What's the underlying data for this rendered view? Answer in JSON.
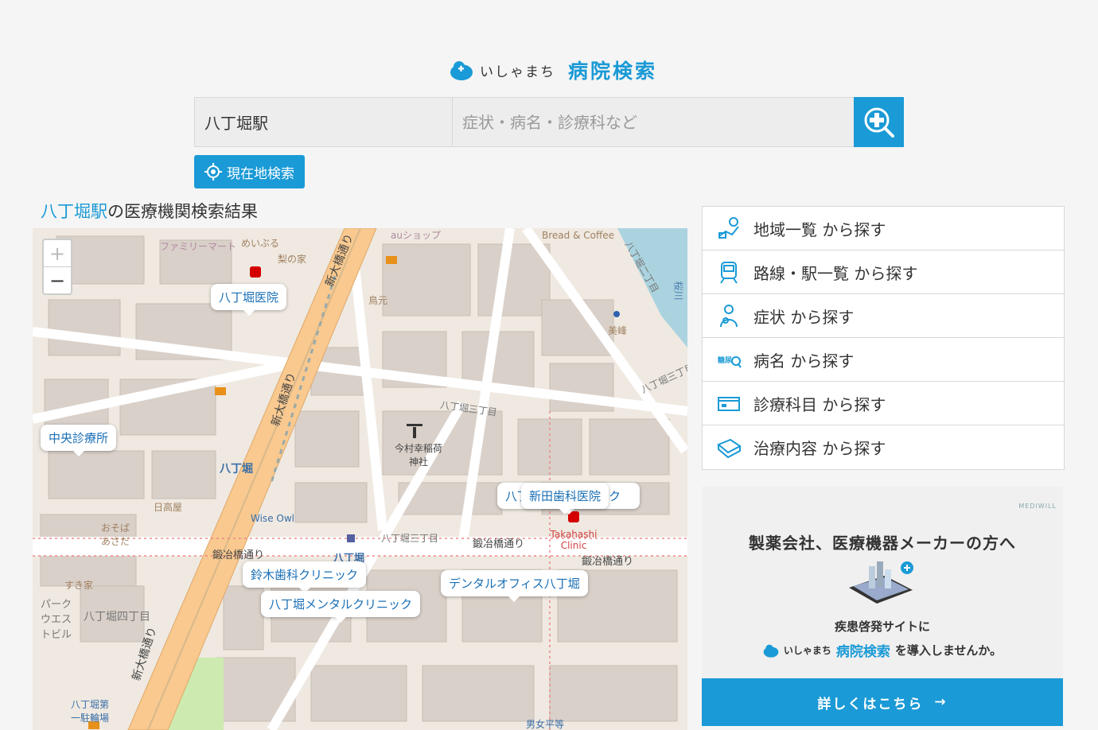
{
  "header": {
    "logo_small": "いしゃまち",
    "logo_big": "病院検索"
  },
  "search": {
    "location_value": "八丁堀駅",
    "keyword_placeholder": "症状・病名・診療科など"
  },
  "geo_button": {
    "label": "現在地検索"
  },
  "results": {
    "station": "八丁堀駅",
    "suffix": "の医療機関検索結果"
  },
  "map": {
    "zoom_in": "+",
    "zoom_out": "−",
    "popups": [
      "八丁堀医院",
      "中央診療所",
      "新田歯科医院",
      "鈴木歯科クリニック",
      "八丁堀メンタルクリニック",
      "デンタルオフィス八丁堀",
      "八丁"
    ],
    "popup_partial_suffix": "ク",
    "labels": {
      "family_mart": "ファミリーマート",
      "meiburu": "めいぶる",
      "nashinoie": "梨の家",
      "au": "auショップ",
      "bread": "Bread & Coffee",
      "torigen": "鳥元",
      "shin_ohashi1": "新大橋通り",
      "shin_ohashi2": "新大橋通り",
      "shin_ohashi3": "新大橋通り",
      "hatchobori2": "八丁堀二丁目",
      "hatchobori3a": "八丁堀三丁目",
      "hatchobori3b": "八丁堀三丁目",
      "hatchobori4": "八丁堀四丁目",
      "hatchobori_st": "八丁堀",
      "hatchobori_big": "八丁堀",
      "shrine": "今村幸稲荷神社",
      "takahashi": "Takahashi Clinic",
      "kajibashi1": "鍛冶橋通り",
      "kajibashi2": "鍛冶橋通り",
      "kajibashi3": "鍛冶橋通り",
      "hidaka": "日高屋",
      "osoba": "おそば あさだ",
      "sukiya": "すき家",
      "park_west": "パーク ウエス トビル",
      "wise_owl": "Wise Owl",
      "mimine": "美峰",
      "parking": "八丁堀第一駐輪場",
      "danjo": "男女平等",
      "sakura": "桜川"
    }
  },
  "side_list": [
    {
      "label": "地域一覧 から探す",
      "icon": "map-region-icon"
    },
    {
      "label": "路線・駅一覧 から探す",
      "icon": "train-icon"
    },
    {
      "label": "症状 から探す",
      "icon": "symptom-person-icon"
    },
    {
      "label": "病名 から探す",
      "icon": "disease-icon"
    },
    {
      "label": "診療科目 から探す",
      "icon": "department-icon"
    },
    {
      "label": "治療内容 から探す",
      "icon": "treatment-book-icon"
    }
  ],
  "ad": {
    "brand": "MEDIWILL",
    "title": "製薬会社、医療機器メーカーの方へ",
    "sub": "疾患啓発サイトに",
    "line_small": "いしゃまち",
    "line_blue": "病院検索",
    "line_tail": "を導入しませんか。",
    "cta": "詳しくはこちら",
    "cta_arrow": "→"
  },
  "colors": {
    "accent": "#1a9ad6",
    "road_major": "#f9c98f",
    "map_bg": "#efe9e1",
    "building": "#d9d0c9"
  }
}
